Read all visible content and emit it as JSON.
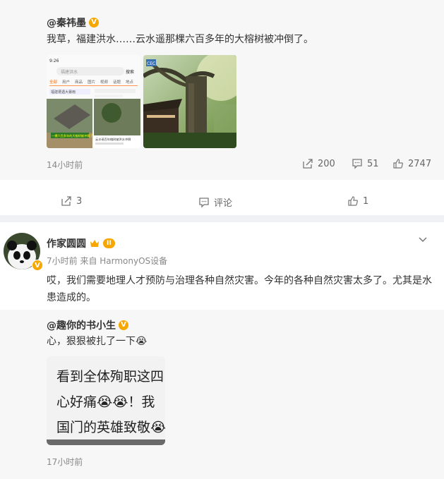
{
  "repost": {
    "author": "@秦祎墨",
    "text": "我草，福建洪水……云水遥那棵六百多年的大榕树被冲倒了。",
    "time": "14小时前",
    "stats": {
      "repost": "200",
      "comment": "51",
      "like": "2747"
    },
    "screenshot": {
      "time": "9:26",
      "search": "福建洪水",
      "search_btn": "搜索",
      "tabs": [
        "全部",
        "用户",
        "商品",
        "图片",
        "视频",
        "话题",
        "地点"
      ],
      "chip": "福建遭遇大暴雨",
      "caption1": "一棵六百多年的大榕树被冲倒了",
      "caption2": "云水谣百年榕树被洪水冲倒"
    },
    "photo_tag": "CEC"
  },
  "actions": {
    "repost": "3",
    "comment": "评论",
    "like": "1"
  },
  "comment": {
    "author": "作家圆圆",
    "level": "II",
    "meta": "7小时前 来自 HarmonyOS设备",
    "text": "哎，我们需要地理人才预防与治理各种自然灾害。今年的各种自然灾害太多了。尤其是水患造成的。"
  },
  "quoted": {
    "author": "@趣你的书小生",
    "text": "心，狠狠被扎了一下",
    "emoji": "😭",
    "image_lines": [
      "看到全体殉职这四",
      "心好痛😭😭！我",
      "国门的英雄致敬😭"
    ],
    "time": "17小时前"
  },
  "colors": {
    "orange": "#f7a700",
    "gray_bg": "#f7f7f7",
    "page_bg": "#f0f1f4"
  }
}
